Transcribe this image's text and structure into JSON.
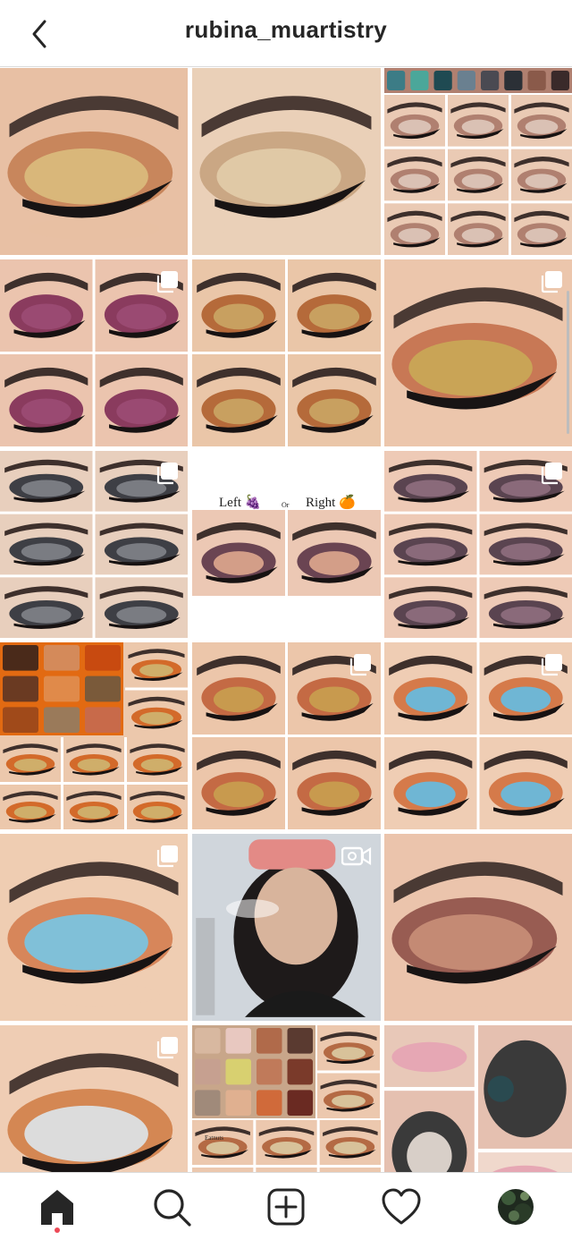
{
  "header": {
    "username": "rubina_muartistry",
    "back_icon": "chevron-left-icon"
  },
  "grid": {
    "tiles": [
      {
        "id": "post-1",
        "type": "photo",
        "skin": "#e8c0a4",
        "shadow": "#c27b50",
        "lid": "#d9b77a"
      },
      {
        "id": "post-2",
        "type": "photo",
        "skin": "#ead0b8",
        "shadow": "#c4a07a",
        "lid": "#e0c9a6"
      },
      {
        "id": "post-3",
        "type": "photo",
        "skin": "#eacab4",
        "shadow": "#b08070",
        "lid": "#dac1b4"
      },
      {
        "id": "post-4",
        "type": "carousel",
        "skin": "#ebc4ae",
        "shadow": "#8a3b5e",
        "lid": "#9a4a72"
      },
      {
        "id": "post-5",
        "type": "photo",
        "skin": "#eac6a8",
        "shadow": "#b56a3a",
        "lid": "#c8a060"
      },
      {
        "id": "post-6",
        "type": "carousel",
        "skin": "#ecc6ac",
        "shadow": "#c26a45",
        "lid": "#c9a456"
      },
      {
        "id": "post-7",
        "type": "carousel",
        "skin": "#e8cfbd",
        "shadow": "#3e3f45",
        "lid": "#7a7c82"
      },
      {
        "id": "post-8",
        "type": "photo",
        "skin": "#ecc8b4",
        "shadow": "#6a4452",
        "lid": "#d39e88",
        "left_label": "Left 🍇",
        "or_label": "Or",
        "right_label": "Right 🍊"
      },
      {
        "id": "post-9",
        "type": "carousel",
        "skin": "#eecab6",
        "shadow": "#5a4450",
        "lid": "#8a6a7a"
      },
      {
        "id": "post-10",
        "type": "photo",
        "skin": "#ecc8ac",
        "shadow": "#d36a2a",
        "lid": "#cfae6a"
      },
      {
        "id": "post-11",
        "type": "carousel",
        "skin": "#ecc6aa",
        "shadow": "#c46a44",
        "lid": "#c89a4e"
      },
      {
        "id": "post-12",
        "type": "carousel",
        "skin": "#efcdb4",
        "shadow": "#d57a4a",
        "lid": "#6fb6d4"
      },
      {
        "id": "post-13",
        "type": "carousel",
        "skin": "#efcdb2",
        "shadow": "#d2794a",
        "lid": "#80c0d8"
      },
      {
        "id": "post-14",
        "type": "video",
        "skin": "#d8b49c",
        "shadow": "#c98880",
        "lid": "#d6c0b0"
      },
      {
        "id": "post-15",
        "type": "photo",
        "skin": "#ebc4ac",
        "shadow": "#8a4a42",
        "lid": "#c48a74"
      },
      {
        "id": "post-16",
        "type": "carousel",
        "skin": "#efcdb4",
        "shadow": "#cf7a42",
        "lid": "#dcdcdc"
      },
      {
        "id": "post-17",
        "type": "photo",
        "skin": "#ecc8ae",
        "shadow": "#b46a44",
        "lid": "#d8c29a",
        "palette_label": "Eatnuts"
      },
      {
        "id": "post-18",
        "type": "photo",
        "skin": "#e5c0b0",
        "shadow": "#3a3a3a",
        "lid": "#e6a7b4"
      }
    ]
  },
  "tabbar": {
    "items": [
      {
        "name": "home",
        "icon": "home-icon"
      },
      {
        "name": "search",
        "icon": "search-icon"
      },
      {
        "name": "new-post",
        "icon": "add-post-icon"
      },
      {
        "name": "activity",
        "icon": "heart-icon"
      },
      {
        "name": "profile",
        "icon": "avatar"
      }
    ]
  },
  "colors": {
    "text": "#262626",
    "divider": "#dbdbdb",
    "notification": "#ed4956"
  }
}
